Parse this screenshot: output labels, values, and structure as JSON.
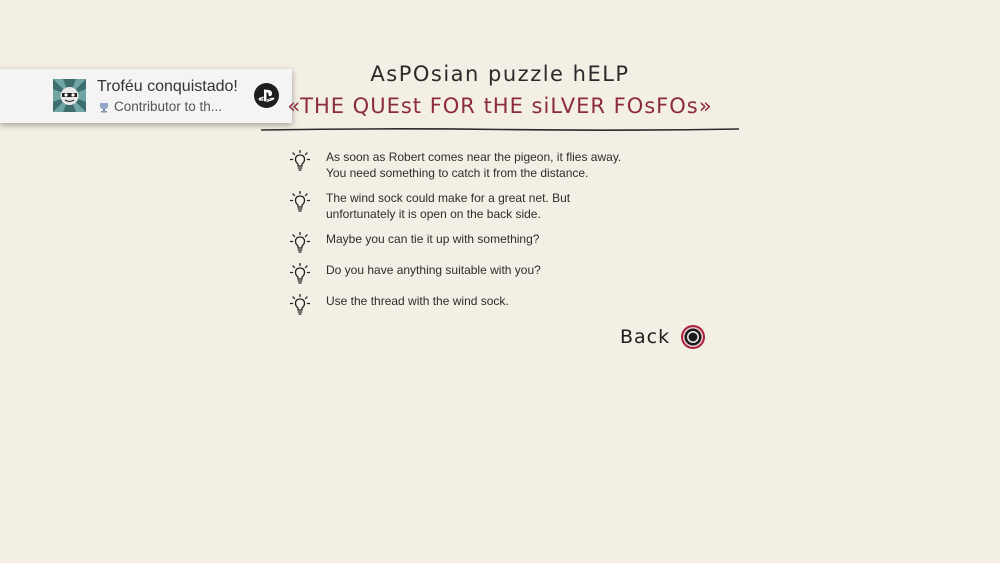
{
  "notification": {
    "title": "Troféu conquistado!",
    "subtitle": "Contributor to th...",
    "icons": [
      "trophy-art-icon",
      "bronze-trophy-icon",
      "playstation-icon"
    ]
  },
  "help": {
    "title": "AsPOsian puzzle hELP",
    "subtitle": "«THE QUEst FOR tHE siLVER FOsFOs»",
    "hints": [
      [
        "As soon as Robert comes near the pigeon, it flies away.",
        "You need something to catch it from the distance."
      ],
      [
        "The wind sock could make for a great net. But",
        "unfortunately it is open on the back side."
      ],
      [
        "Maybe you can tie it up with something?"
      ],
      [
        "Do you have anything suitable with you?"
      ],
      [
        "Use the thread with the wind sock."
      ]
    ],
    "hint_icon": "lightbulb-icon",
    "back_label": "Back",
    "back_button_icon": "circle-button-icon"
  },
  "colors": {
    "background": "#f3efe4",
    "subtitle": "#8c2b3b",
    "circle_button": "#a8203a"
  }
}
